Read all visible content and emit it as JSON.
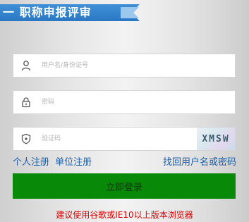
{
  "header": {
    "title": "一 职称申报评审"
  },
  "form": {
    "username": {
      "placeholder": "用户名/身份证号",
      "value": "",
      "icon": "user-icon"
    },
    "password": {
      "placeholder": "密码",
      "value": "",
      "icon": "lock-icon"
    },
    "captcha": {
      "placeholder": "验证码",
      "value": "",
      "icon": "shield-icon",
      "image_text": "XMSW"
    },
    "submit_label": "立即登录"
  },
  "links": {
    "personal_register": "个人注册",
    "unit_register": "单位注册",
    "recover": "找回用户名或密码"
  },
  "notice": "建议使用谷歌或IE10以上版本浏览器",
  "colors": {
    "banner": "#2a78c4",
    "submit": "#088a08",
    "link": "#1f5fa8",
    "notice": "#d40000"
  }
}
